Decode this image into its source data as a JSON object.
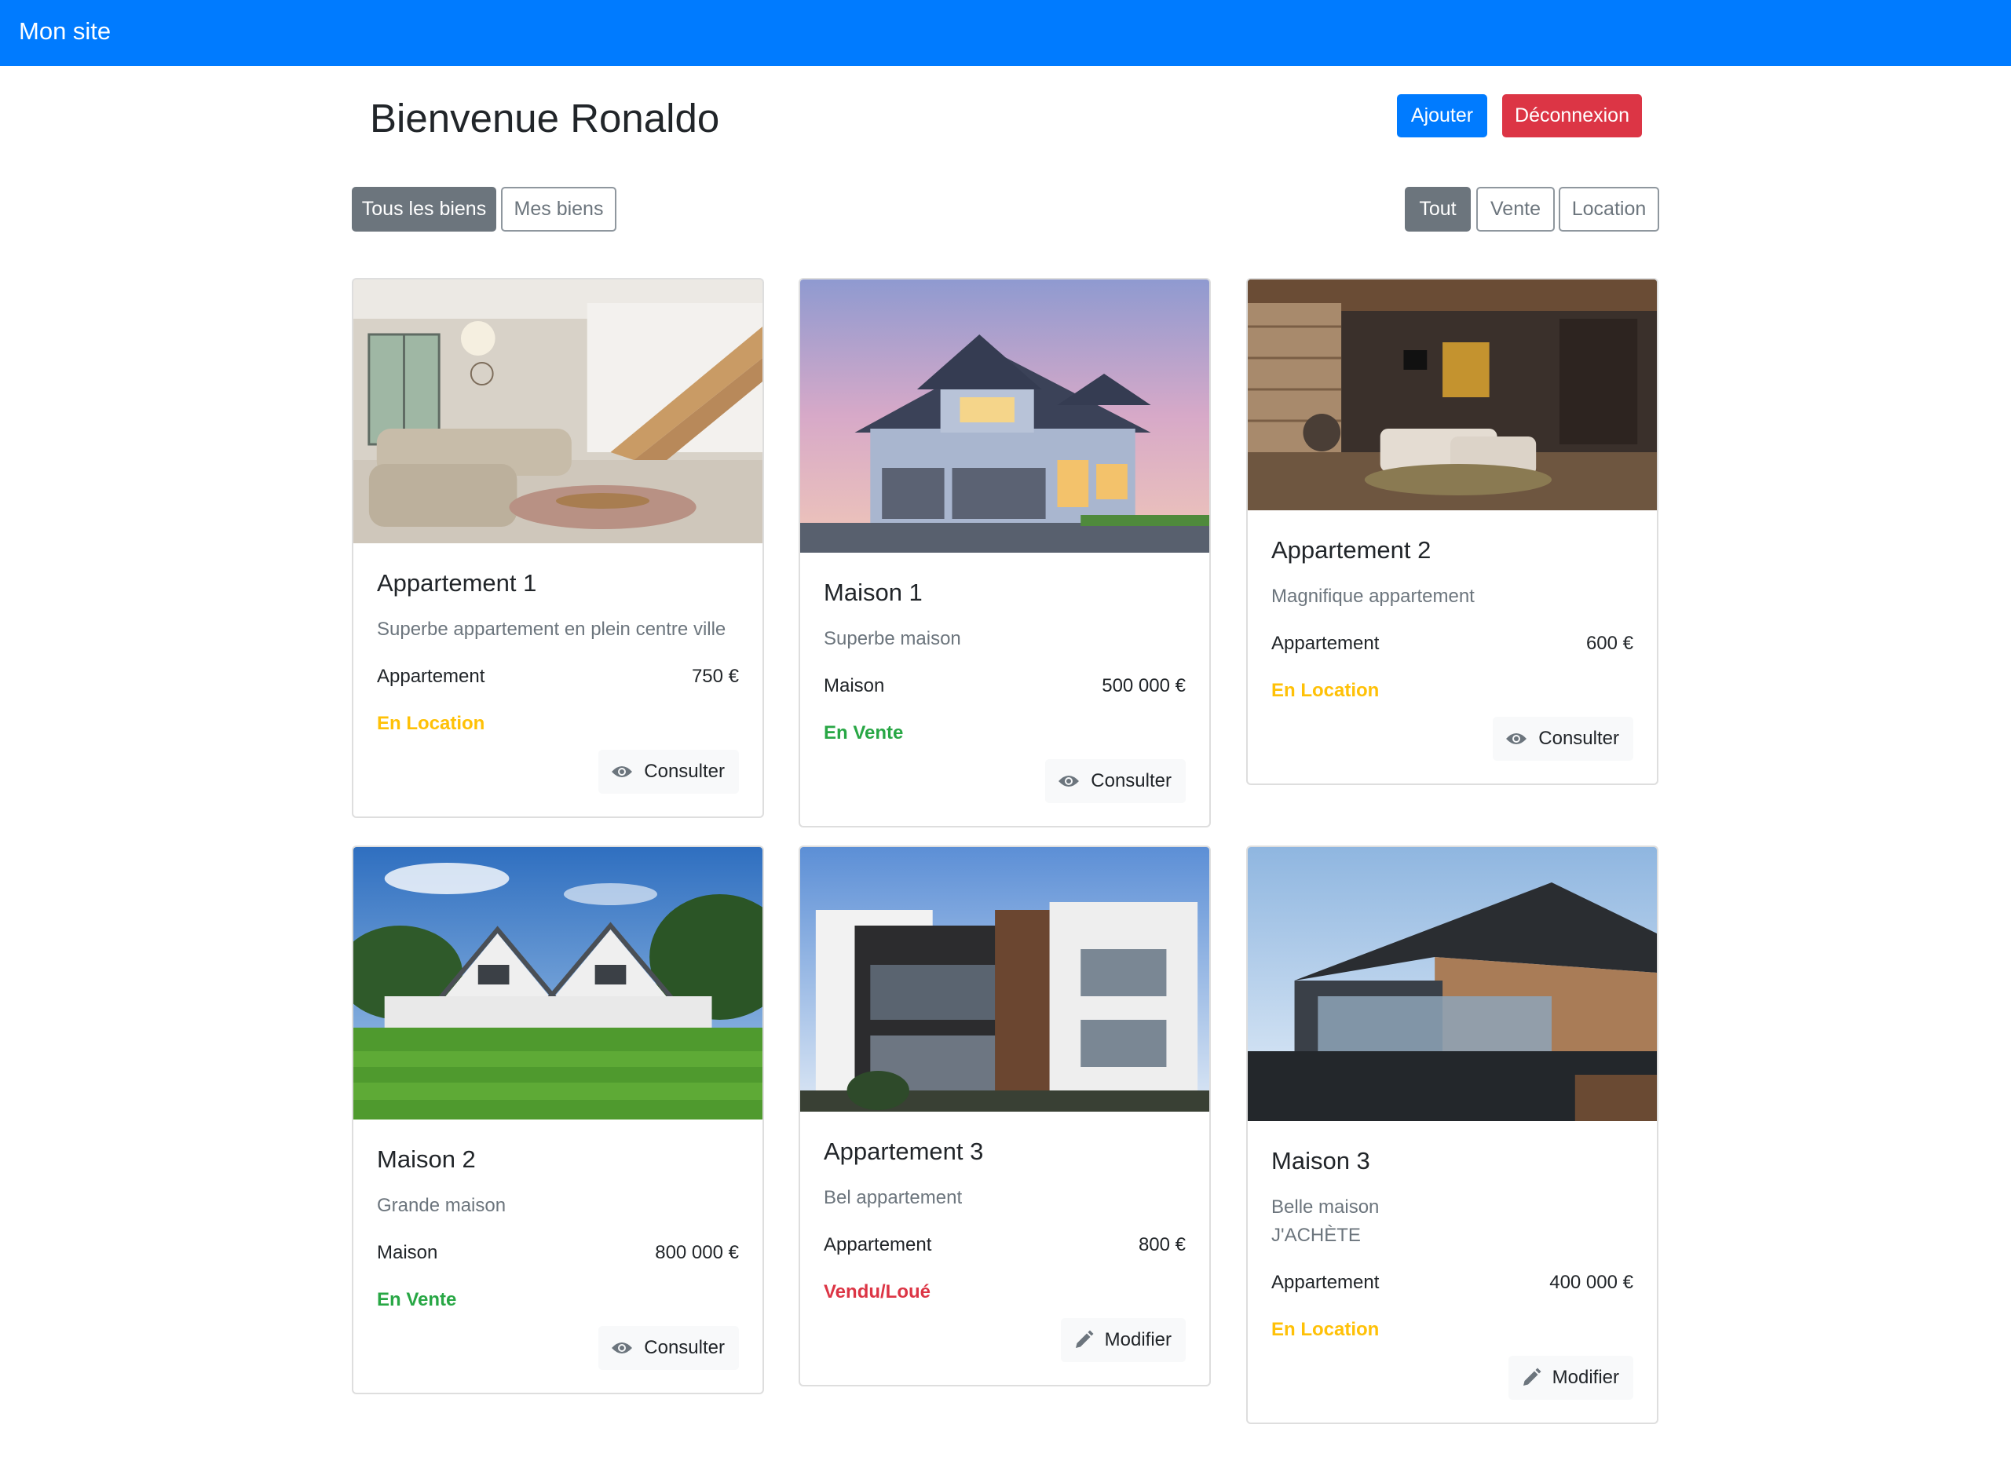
{
  "navbar": {
    "brand": "Mon site"
  },
  "header": {
    "title": "Bienvenue Ronaldo",
    "add_button": "Ajouter",
    "logout_button": "Déconnexion"
  },
  "owner_filter": {
    "all": "Tous les biens",
    "mine": "Mes biens",
    "selected": "Tous les biens"
  },
  "type_filter": {
    "all": "Tout",
    "sale": "Vente",
    "rent": "Location",
    "selected": "Tout"
  },
  "colors": {
    "primary": "#007bff",
    "danger": "#dc3545",
    "secondary": "#6c757d",
    "warning": "#ffc107",
    "success": "#28a745"
  },
  "properties": [
    {
      "title": "Appartement 1",
      "description": "Superbe appartement en plein centre ville",
      "type": "Appartement",
      "price": "750 €",
      "status": "En Location",
      "action": "Consulter",
      "action_icon": "eye-icon",
      "image": "living-room-with-staircase"
    },
    {
      "title": "Maison 1",
      "description": "Superbe maison",
      "type": "Maison",
      "price": "500 000 €",
      "status": "En Vente",
      "action": "Consulter",
      "action_icon": "eye-icon",
      "image": "house-at-dusk"
    },
    {
      "title": "Appartement 2",
      "description": "Magnifique appartement",
      "type": "Appartement",
      "price": "600 €",
      "status": "En Location",
      "action": "Consulter",
      "action_icon": "eye-icon",
      "image": "dark-living-room"
    },
    {
      "title": "Maison 2",
      "description": "Grande maison",
      "type": "Maison",
      "price": "800 000 €",
      "status": "En Vente",
      "action": "Consulter",
      "action_icon": "eye-icon",
      "image": "white-house-with-lawn"
    },
    {
      "title": "Appartement 3",
      "description": "Bel appartement",
      "type": "Appartement",
      "price": "800 €",
      "status": "Vendu/Loué",
      "action": "Modifier",
      "action_icon": "pencil-icon",
      "image": "modern-apartment-building"
    },
    {
      "title": "Maison 3",
      "description": "Belle maison",
      "description_extra": "J'ACHÈTE",
      "type": "Appartement",
      "price": "400 000 €",
      "status": "En Location",
      "action": "Modifier",
      "action_icon": "pencil-icon",
      "image": "modern-house-with-balcony"
    }
  ]
}
